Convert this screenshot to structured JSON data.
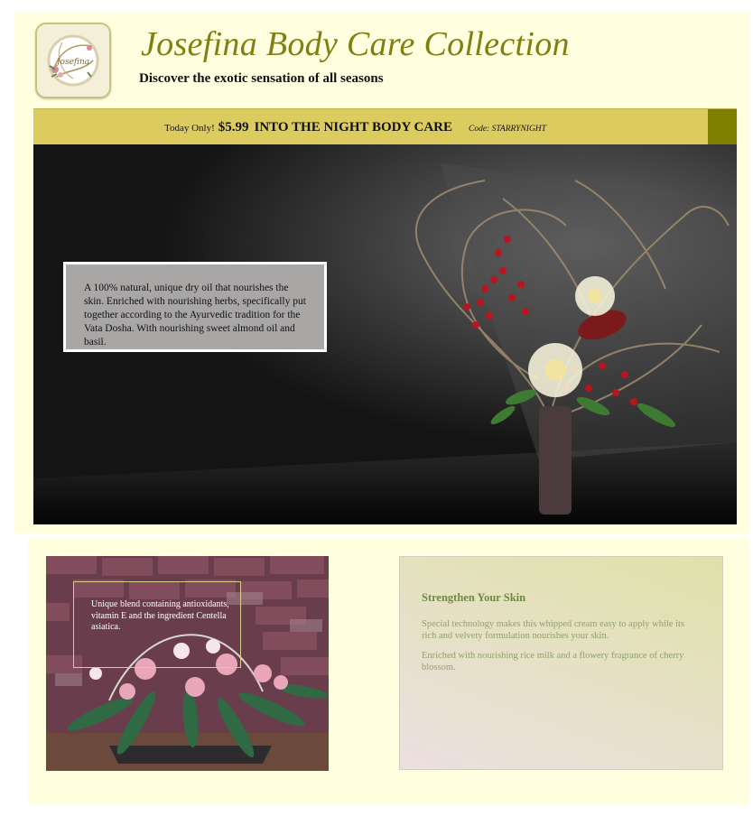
{
  "header": {
    "logo_label": "Josefina",
    "title": "Josefina Body Care Collection",
    "subtitle": "Discover the exotic sensation of all seasons"
  },
  "promo": {
    "today": "Today Only!",
    "price": "$5.99",
    "product": "INTO THE NIGHT BODY CARE",
    "code": "Code: STARRYNIGHT"
  },
  "hero": {
    "caption": "A 100% natural, unique dry oil that nourishes the skin. Enriched with nourishing herbs, specifically put together according to the Ayurvedic tradition for the Vata Dosha. With nourishing sweet almond oil and basil."
  },
  "feature_photo": {
    "caption": "Unique blend containing antioxidants, vitamin E and the ingredient Centella asiatica."
  },
  "info_card": {
    "heading": "Strengthen Your Skin",
    "paragraphs": [
      "Special technology makes this whipped cream easy to apply while its rich and velvety formulation nourishes your skin.",
      "Enriched with nourishing rice milk and a flowery fragrance of cherry blossom."
    ]
  },
  "colors": {
    "panel_bg": "#ffffe0",
    "title_olive": "#808012",
    "promo_gold": "#dccb5e",
    "promo_accent": "#808000",
    "heading_green": "#6f8a43"
  }
}
